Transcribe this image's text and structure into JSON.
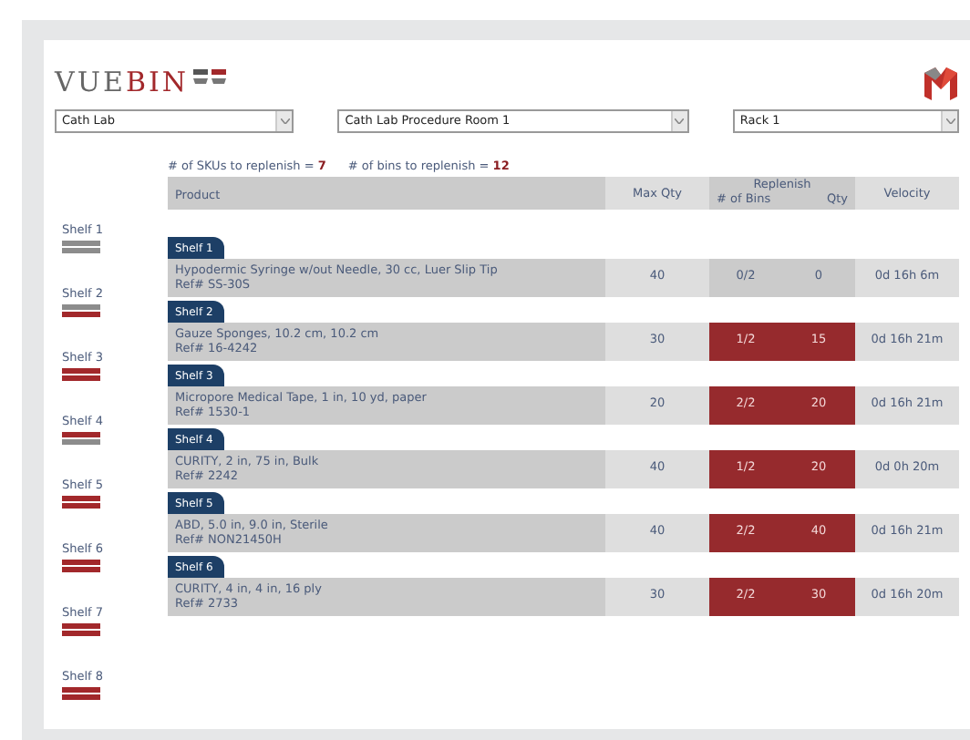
{
  "logo": {
    "text_dark": "VUE",
    "text_accent": "BIN"
  },
  "filters": [
    {
      "value": "Cath Lab"
    },
    {
      "value": "Cath Lab Procedure Room 1"
    },
    {
      "value": "Rack 1"
    }
  ],
  "summary": {
    "skus_label": "# of SKUs to replenish =",
    "skus_value": "7",
    "bins_label": "# of bins to replenish =",
    "bins_value": "12"
  },
  "table": {
    "columns": {
      "product": "Product",
      "max_qty": "Max Qty",
      "replenish": "Replenish",
      "bins": "# of Bins",
      "qty": "Qty",
      "velocity": "Velocity"
    },
    "rows": [
      {
        "shelf": "Shelf 1",
        "product": "Hypodermic Syringe w/out Needle, 30 cc, Luer Slip Tip",
        "ref": "Ref# SS-30S",
        "max_qty": "40",
        "bins": "0/2",
        "qty": "0",
        "velocity": "0d 16h 6m",
        "replenish": false
      },
      {
        "shelf": "Shelf 2",
        "product": "Gauze Sponges, 10.2 cm, 10.2 cm",
        "ref": "Ref# 16-4242",
        "max_qty": "30",
        "bins": "1/2",
        "qty": "15",
        "velocity": "0d 16h 21m",
        "replenish": true
      },
      {
        "shelf": "Shelf 3",
        "product": "Micropore Medical Tape, 1 in, 10 yd, paper",
        "ref": "Ref# 1530-1",
        "max_qty": "20",
        "bins": "2/2",
        "qty": "20",
        "velocity": "0d 16h 21m",
        "replenish": true
      },
      {
        "shelf": "Shelf 4",
        "product": "CURITY, 2 in, 75 in, Bulk",
        "ref": "Ref# 2242",
        "max_qty": "40",
        "bins": "1/2",
        "qty": "20",
        "velocity": "0d 0h 20m",
        "replenish": true
      },
      {
        "shelf": "Shelf 5",
        "product": "ABD, 5.0 in, 9.0 in, Sterile",
        "ref": "Ref# NON21450H",
        "max_qty": "40",
        "bins": "2/2",
        "qty": "40",
        "velocity": "0d 16h 21m",
        "replenish": true
      },
      {
        "shelf": "Shelf 6",
        "product": "CURITY, 4 in, 4 in, 16 ply",
        "ref": "Ref# 2733",
        "max_qty": "30",
        "bins": "2/2",
        "qty": "30",
        "velocity": "0d 16h 20m",
        "replenish": true
      }
    ]
  },
  "shelves": [
    {
      "label": "Shelf 1",
      "bins": [
        {
          "replenish": false
        },
        {
          "replenish": false
        }
      ]
    },
    {
      "label": "Shelf 2",
      "bins": [
        {
          "replenish": false
        },
        {
          "replenish": true
        }
      ]
    },
    {
      "label": "Shelf 3",
      "bins": [
        {
          "replenish": true
        },
        {
          "replenish": true
        }
      ]
    },
    {
      "label": "Shelf 4",
      "bins": [
        {
          "replenish": true
        },
        {
          "replenish": false
        }
      ]
    },
    {
      "label": "Shelf 5",
      "bins": [
        {
          "replenish": true
        },
        {
          "replenish": true
        }
      ]
    },
    {
      "label": "Shelf 6",
      "bins": [
        {
          "replenish": true
        },
        {
          "replenish": true
        }
      ]
    },
    {
      "label": "Shelf 7",
      "bins": [
        {
          "replenish": true
        },
        {
          "replenish": true
        }
      ]
    },
    {
      "label": "Shelf 8",
      "bins": [
        {
          "replenish": true
        },
        {
          "replenish": true
        }
      ]
    }
  ]
}
